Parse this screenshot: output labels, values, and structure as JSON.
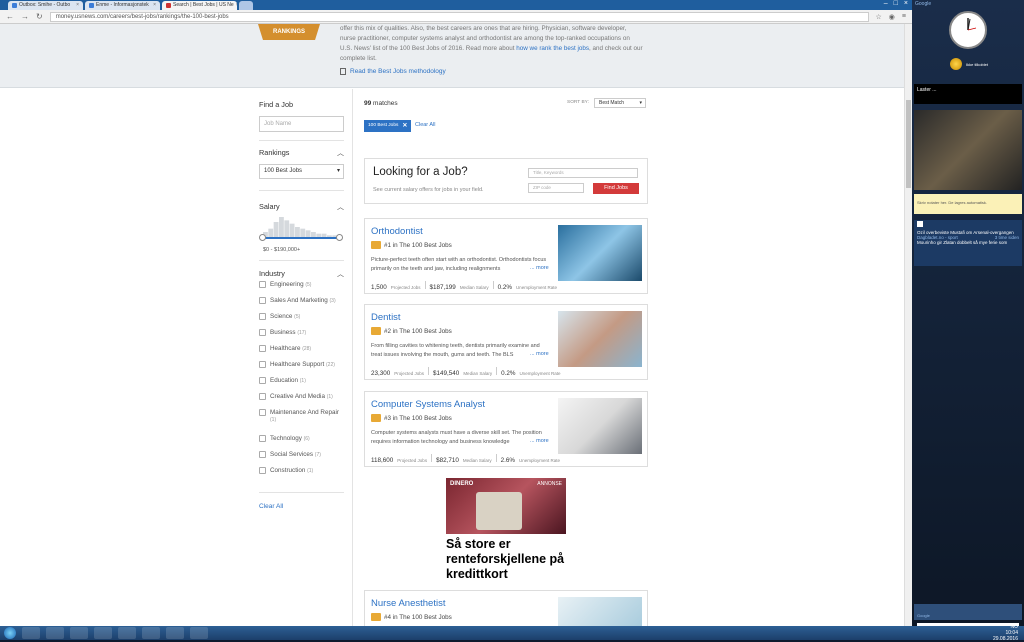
{
  "browser": {
    "tabs": [
      {
        "label": "Outbox: Smihe - Outbo"
      },
      {
        "label": "Enme - Informasjonstek"
      },
      {
        "label": "Search | Best Jobs | US Ne",
        "active": true
      },
      {
        "label": ""
      }
    ],
    "url": "money.usnews.com/careers/best-jobs/rankings/the-100-best-jobs"
  },
  "hero": {
    "ribbon": "RANKINGS",
    "text_lines": [
      "offer this mix of qualities. Also, the best careers are ones that are hiring. Physician, software developer,",
      "nurse practitioner, computer systems analyst and orthodontist are among the top-ranked occupations on",
      "U.S. News' list of the 100 Best Jobs of 2016. Read more about "
    ],
    "rank_link": "how we rank the best jobs",
    "text_tail": ", and check out our",
    "text_last": "complete list.",
    "methodology_link": "Read the Best Jobs methodology"
  },
  "sidebar": {
    "find_job_heading": "Find a Job",
    "job_name_placeholder": "Job Name",
    "rankings_heading": "Rankings",
    "rankings_selected": "100 Best Jobs",
    "salary_heading": "Salary",
    "salary_range": "$0 - $190,000+",
    "salary_hist": [
      3,
      5,
      9,
      12,
      10,
      8,
      6,
      5,
      4,
      3,
      2,
      2,
      1,
      1,
      1
    ],
    "industry_heading": "Industry",
    "industries": [
      {
        "label": "Engineering",
        "count": "(5)"
      },
      {
        "label": "Sales And Marketing",
        "count": "(3)"
      },
      {
        "label": "Science",
        "count": "(5)"
      },
      {
        "label": "Business",
        "count": "(17)"
      },
      {
        "label": "Healthcare",
        "count": "(28)"
      },
      {
        "label": "Healthcare Support",
        "count": "(22)"
      },
      {
        "label": "Education",
        "count": "(1)"
      },
      {
        "label": "Creative And Media",
        "count": "(1)"
      },
      {
        "label": "Maintenance And Repair",
        "count": "(1)"
      },
      {
        "label": "Technology",
        "count": "(6)"
      },
      {
        "label": "Social Services",
        "count": "(7)"
      },
      {
        "label": "Construction",
        "count": "(1)"
      }
    ],
    "clear_all": "Clear All"
  },
  "results": {
    "matches_count": "99",
    "matches_label": "matches",
    "sort_label": "SORT BY:",
    "sort_value": "Best Match",
    "filter_chip": "100 Best Jobs",
    "clear_all": "Clear All",
    "promo": {
      "title": "Looking for a Job?",
      "subtitle": "See current salary offers for jobs in your field.",
      "title_placeholder": "Title, Keywords",
      "zip_placeholder": "ZIP code",
      "button": "Find Jobs"
    },
    "jobs": [
      {
        "title": "Orthodontist",
        "rank": "#1 in The 100 Best Jobs",
        "desc": "Picture-perfect teeth often start with an orthodontist. Orthodontists focus primarily on the teeth and jaw, including realignments",
        "jobs": "1,500",
        "salary": "$187,199",
        "unemp": "0.2%"
      },
      {
        "title": "Dentist",
        "rank": "#2 in The 100 Best Jobs",
        "desc": "From filling cavities to whitening teeth, dentists primarily examine and treat issues involving the mouth, gums and teeth. The BLS",
        "jobs": "23,300",
        "salary": "$149,540",
        "unemp": "0.2%"
      },
      {
        "title": "Computer Systems Analyst",
        "rank": "#3 in The 100 Best Jobs",
        "desc": "Computer systems analysts must have a diverse skill set. The position requires information technology and business knowledge",
        "jobs": "118,600",
        "salary": "$82,710",
        "unemp": "2.6%"
      },
      {
        "title": "Nurse Anesthetist",
        "rank": "#4 in The 100 Best Jobs",
        "desc": "",
        "jobs": "",
        "salary": "",
        "unemp": ""
      }
    ],
    "more": "... more",
    "lbl_jobs": "Projected Jobs",
    "lbl_salary": "Median Salary",
    "lbl_unemp": "Unemployment Rate"
  },
  "ad": {
    "brand": "DINERO",
    "tag": "ANNONSE",
    "text": "Så store er renteforskjellene på kredittkort"
  },
  "gadgets": {
    "google": "Google",
    "weather": "Ikke tilkoblet",
    "feed_title": "Laster ...",
    "note": "Skriv notater her. De lagres automatisk.",
    "news": [
      {
        "title": "Ozil overbeviste Mustafi om Arsenal-overgangen",
        "source": "Dagbladet.no - sport",
        "time": "3 time siden"
      },
      {
        "title": "Mourinho gir Zlatan dobbelt så mye ferie som",
        "source": "",
        "time": ""
      }
    ],
    "search": "Google"
  },
  "taskbar": {
    "apps": [
      "",
      "",
      "",
      "",
      "",
      "",
      "",
      "",
      "",
      ""
    ],
    "time": "10:04",
    "date": "29.08.2016",
    "lang": "NO"
  }
}
